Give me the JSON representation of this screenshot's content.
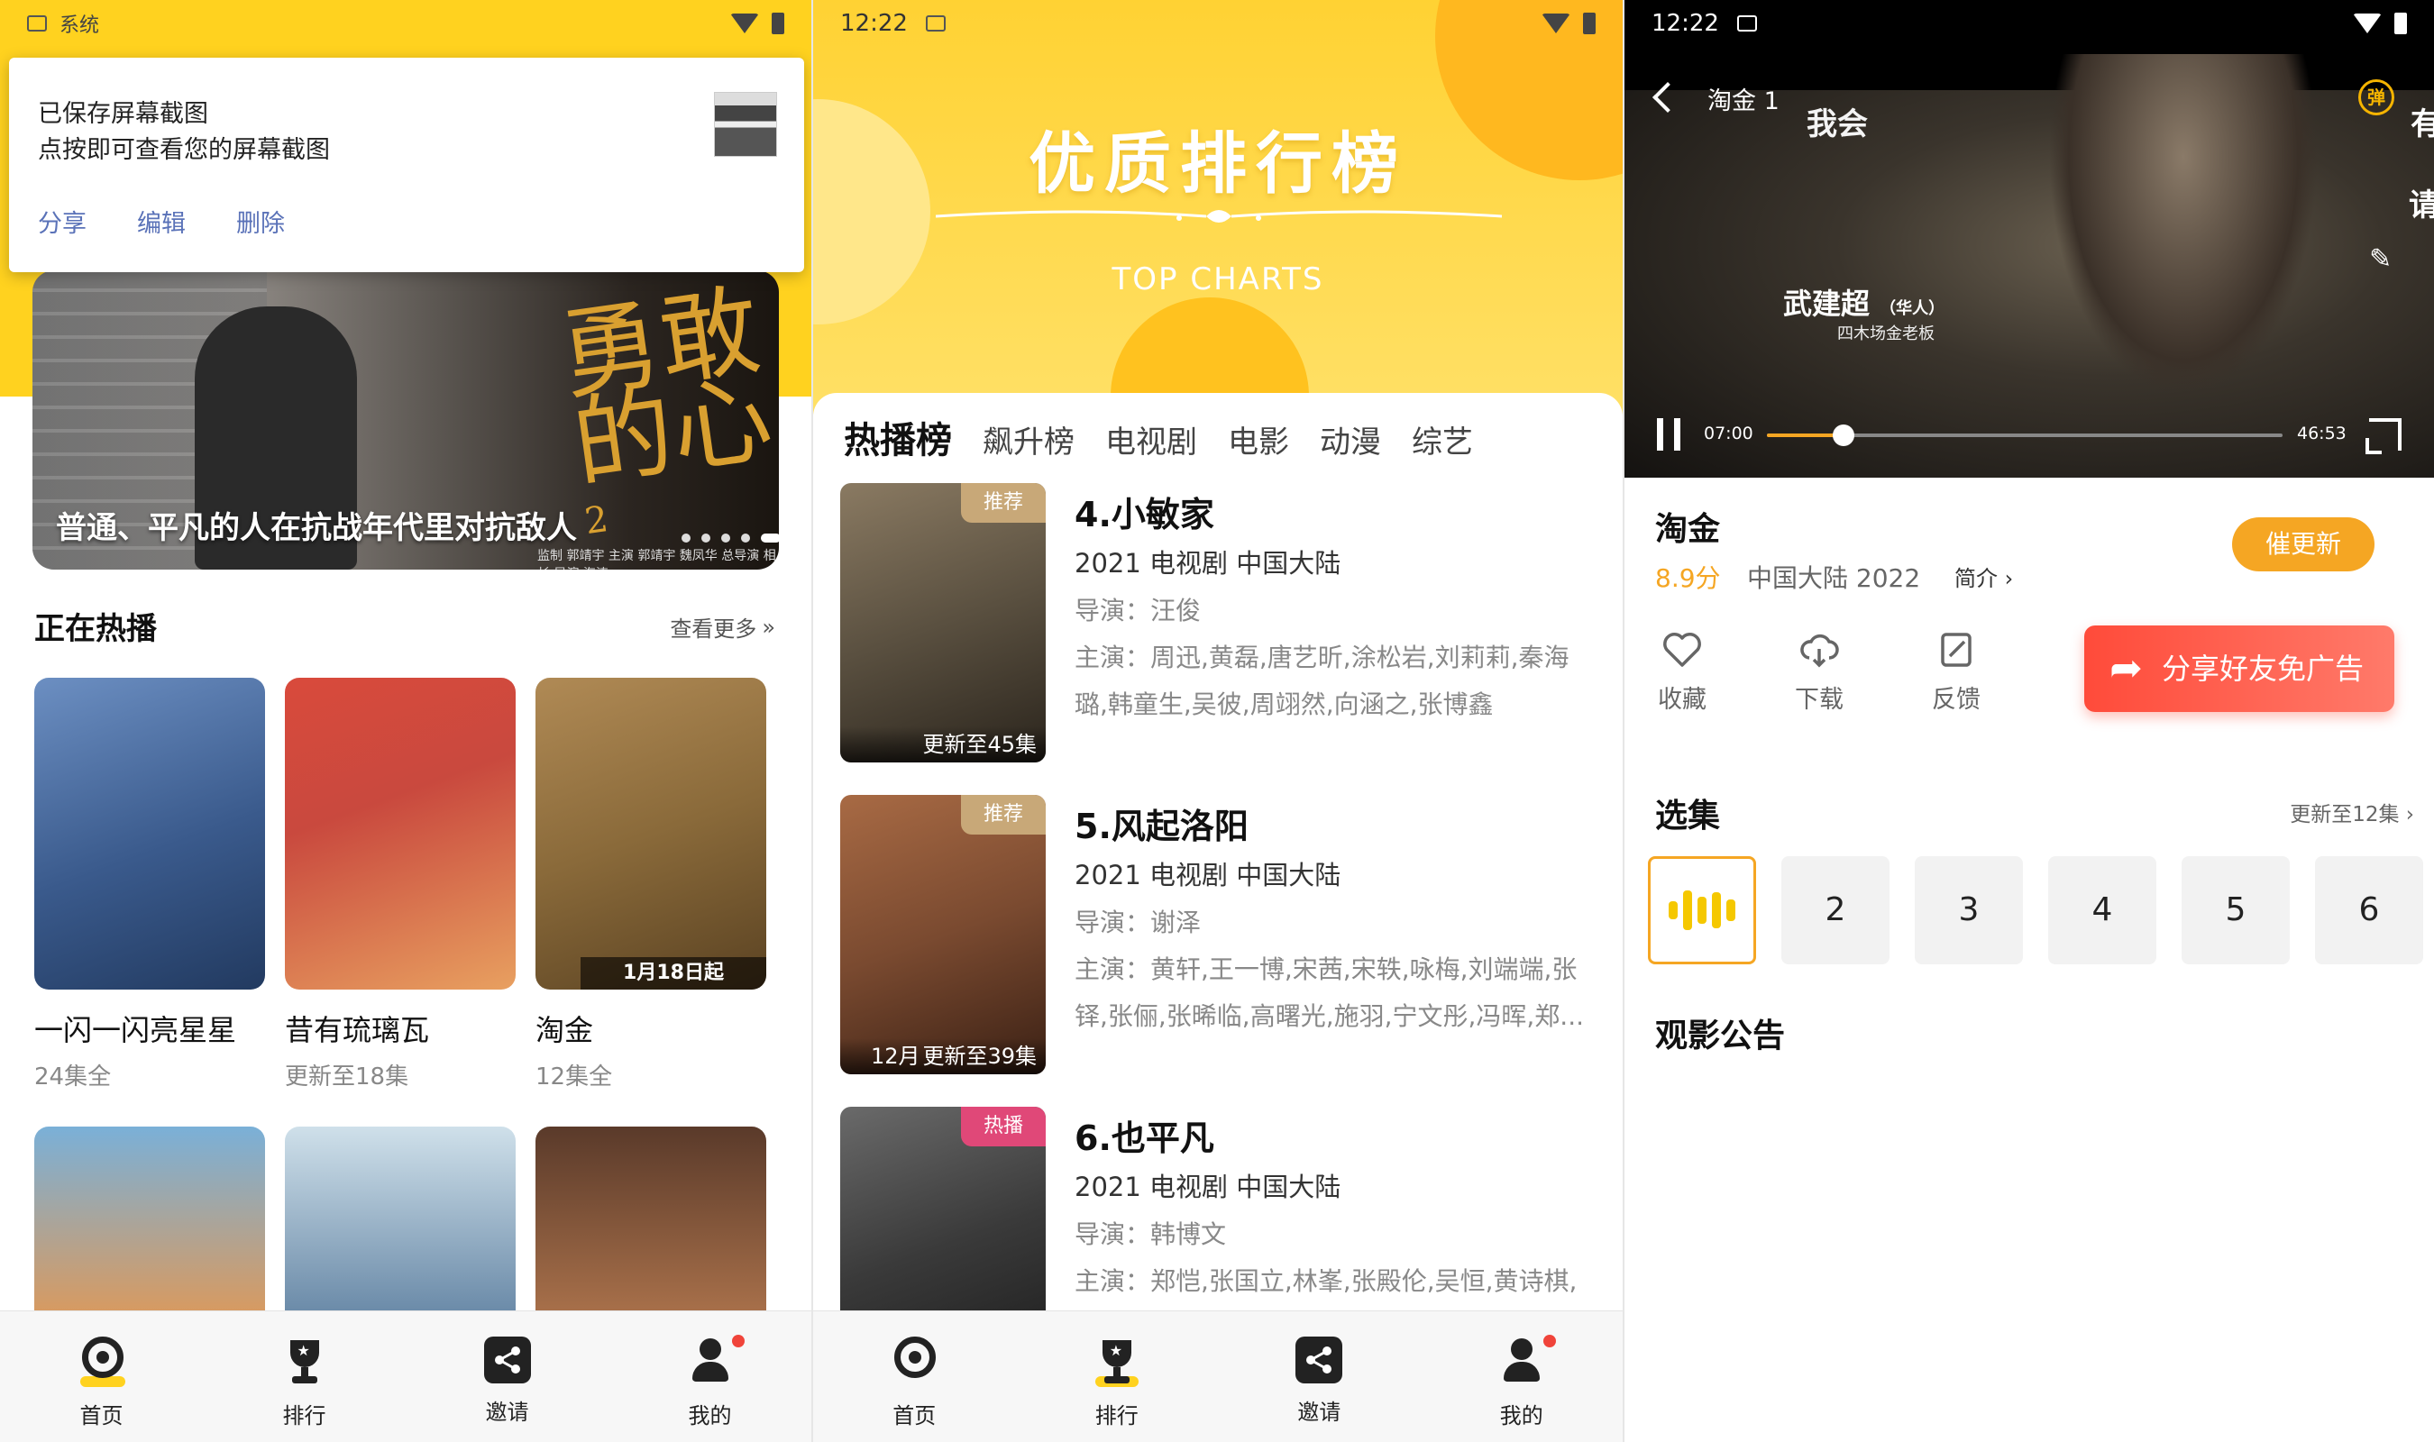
{
  "panel1": {
    "status": {
      "label": "系统"
    },
    "notification": {
      "title": "已保存屏幕截图",
      "subtitle": "点按即可查看您的屏幕截图",
      "actions": [
        "分享",
        "编辑",
        "删除"
      ]
    },
    "hero": {
      "caption": "普通、平凡的人在抗战年代里对抗敌人",
      "calligraphy": "勇敢的心",
      "superscript": "2",
      "credits": "监制 郭靖宇   主演 郭靖宇 魏凤华   总导演 相杉   导演 海涛"
    },
    "section": {
      "title": "正在热播",
      "more": "查看更多"
    },
    "shows": [
      {
        "title": "一闪一闪亮星星",
        "sub": "24集全",
        "color": "#4b6a9c"
      },
      {
        "title": "昔有琉璃瓦",
        "sub": "更新至18集",
        "color": "#c9493e"
      },
      {
        "title": "淘金",
        "sub": "12集全",
        "color": "#8a6a3a",
        "badge": "1月18日起"
      }
    ],
    "tabbar": [
      "首页",
      "排行",
      "邀请",
      "我的"
    ]
  },
  "panel2": {
    "status": {
      "time": "12:22"
    },
    "banner": {
      "title": "优质排行榜",
      "subtitle": "TOP CHARTS"
    },
    "tabs": [
      "热播榜",
      "飙升榜",
      "电视剧",
      "电影",
      "动漫",
      "综艺"
    ],
    "items": [
      {
        "rank_title": "4.小敏家",
        "meta": "2021  电视剧  中国大陆",
        "director": "导演：汪俊",
        "cast": "主演：周迅,黄磊,唐艺昕,涂松岩,刘莉莉,秦海璐,韩童生,吴彼,周翊然,向涵之,张博鑫",
        "tag": "推荐",
        "episodes": "更新至45集",
        "tag_color": "#c8a878",
        "poster_color": "#5a5040"
      },
      {
        "rank_title": "5.风起洛阳",
        "meta": "2021  电视剧  中国大陆",
        "director": "导演：谢泽",
        "cast": "主演：黄轩,王一博,宋茜,宋轶,咏梅,刘端端,张铎,张俪,张晞临,高曙光,施羽,宁文彤,冯晖,郑...",
        "tag": "推荐",
        "episodes": "更新至39集",
        "poster_overlay": "12月",
        "tag_color": "#c8a878",
        "poster_color": "#7a4a30"
      },
      {
        "rank_title": "6.也平凡",
        "meta": "2021  电视剧  中国大陆",
        "director": "导演：韩博文",
        "cast": "主演：郑恺,张国立,林峯,张殿伦,吴恒,黄诗棋,",
        "tag": "热播",
        "episodes": "",
        "tag_color": "#e04878",
        "poster_color": "#3a3a3a"
      }
    ],
    "tabbar": [
      "首页",
      "排行",
      "邀请",
      "我的"
    ]
  },
  "panel3": {
    "status": {
      "time": "12:22"
    },
    "video": {
      "title": "淘金 1",
      "danmu": [
        "我会",
        "有",
        "请"
      ],
      "danmu_button": "弹",
      "on_screen_name": "武建超",
      "on_screen_name_note": "（华人）",
      "on_screen_role": "四木场金老板",
      "current_time": "07:00",
      "total_time": "46:53",
      "progress": 0.149
    },
    "detail": {
      "title": "淘金",
      "score": "8.9分",
      "meta": "中国大陆  2022",
      "intro": "简介",
      "urge_button": "催更新",
      "actions": [
        "收藏",
        "下载",
        "反馈"
      ],
      "share_button": "分享好友免广告"
    },
    "episodes": {
      "title": "选集",
      "more": "更新至12集",
      "list": [
        "2",
        "3",
        "4",
        "5",
        "6"
      ]
    },
    "notice": "观影公告"
  }
}
